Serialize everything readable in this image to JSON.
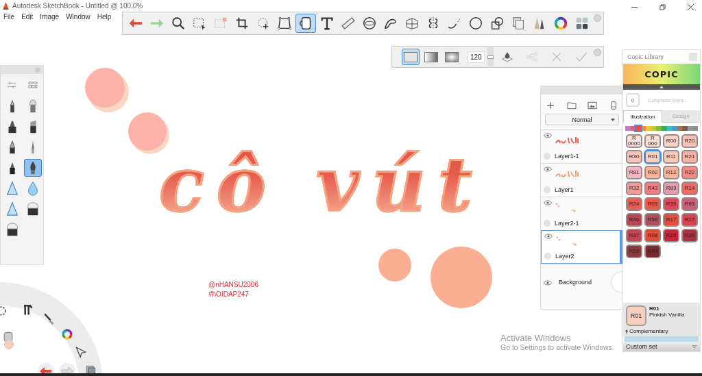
{
  "window": {
    "title": "Autodesk SketchBook - Untitled @ 100.0%"
  },
  "menu": [
    "File",
    "Edit",
    "Image",
    "Window",
    "Help"
  ],
  "toolbar": [
    {
      "kind": "undo",
      "selected": false
    },
    {
      "kind": "redo",
      "selected": false
    },
    {
      "kind": "zoom",
      "selected": false
    },
    {
      "kind": "select",
      "selected": false
    },
    {
      "kind": "select-clear",
      "selected": false
    },
    {
      "kind": "crop",
      "selected": false
    },
    {
      "kind": "transform",
      "selected": false
    },
    {
      "kind": "distort",
      "selected": false
    },
    {
      "kind": "fill",
      "selected": true
    },
    {
      "kind": "text",
      "selected": false
    },
    {
      "kind": "ruler",
      "selected": false
    },
    {
      "kind": "ellipse",
      "selected": false
    },
    {
      "kind": "curve",
      "selected": false
    },
    {
      "kind": "perspective",
      "selected": false
    },
    {
      "kind": "symmetry",
      "selected": false
    },
    {
      "kind": "stroke",
      "selected": false
    },
    {
      "kind": "predictive",
      "selected": false
    },
    {
      "kind": "shapes",
      "selected": false
    },
    {
      "kind": "layers",
      "selected": false
    },
    {
      "kind": "brushes",
      "selected": false
    },
    {
      "kind": "colorwheel",
      "selected": false
    },
    {
      "kind": "swatches",
      "selected": false
    }
  ],
  "fill_toolbar": {
    "modes": [
      {
        "kind": "solid",
        "selected": true
      },
      {
        "kind": "linear",
        "selected": false
      },
      {
        "kind": "radial",
        "selected": false
      }
    ],
    "tolerance": "120",
    "slider": {
      "level": 0.5
    }
  },
  "brushes": [
    {
      "kind": "pencil",
      "selected": false
    },
    {
      "kind": "airbrush",
      "selected": false
    },
    {
      "kind": "marker",
      "selected": false
    },
    {
      "kind": "chisel",
      "selected": false
    },
    {
      "kind": "pen",
      "selected": false
    },
    {
      "kind": "nib",
      "selected": false
    },
    {
      "kind": "ballpoint",
      "selected": false
    },
    {
      "kind": "ink",
      "selected": true
    },
    {
      "kind": "triangle",
      "selected": false
    },
    {
      "kind": "drop",
      "selected": false
    },
    {
      "kind": "triangle",
      "selected": false
    },
    {
      "kind": "eraser",
      "selected": false
    },
    {
      "kind": "eraser",
      "selected": false
    }
  ],
  "canvas": {
    "lettering": "cô vút",
    "signature": [
      "@nHANSU2006",
      "#hOIDAP247"
    ]
  },
  "layers": {
    "blend_mode": "Normal",
    "items": [
      {
        "name": "Layer1-1",
        "selected": false,
        "visible": true
      },
      {
        "name": "Layer1",
        "selected": false,
        "visible": true
      },
      {
        "name": "Layer2-1",
        "selected": false,
        "visible": true
      },
      {
        "name": "Layer2",
        "selected": true,
        "visible": true
      }
    ],
    "background": {
      "name": "Background",
      "visible": true
    }
  },
  "copic": {
    "title": "Copic Library",
    "logo": "COPIC",
    "blender_code": "0",
    "blender_name": "Colorless Blen...",
    "tabs": [
      {
        "label": "Illustration",
        "selected": true
      },
      {
        "label": "Design",
        "selected": false
      }
    ],
    "hues": [
      {
        "color": "#b784c0",
        "selected": false
      },
      {
        "color": "#e35b7a",
        "selected": false
      },
      {
        "color": "#e8504a",
        "selected": true
      },
      {
        "color": "#f08a3a",
        "selected": false
      },
      {
        "color": "#f5c040",
        "selected": false
      },
      {
        "color": "#c9c93a",
        "selected": false
      },
      {
        "color": "#7ac043",
        "selected": false
      },
      {
        "color": "#3aaa5a",
        "selected": false
      },
      {
        "color": "#3fbfc8",
        "selected": false
      },
      {
        "color": "#4a9ad8",
        "selected": false
      },
      {
        "color": "#a07850",
        "selected": false
      },
      {
        "color": "#7a5a48",
        "selected": false
      },
      {
        "color": "#8a98a0",
        "selected": false
      },
      {
        "color": "#909090",
        "selected": false
      }
    ],
    "swatches": [
      {
        "code": "R 0000",
        "color": "#f6e4dc",
        "selected": false
      },
      {
        "code": "R 000",
        "color": "#f5dfd6",
        "selected": false
      },
      {
        "code": "R00",
        "color": "#f7d3c6",
        "selected": false
      },
      {
        "code": "R20",
        "color": "#f6c0b5",
        "selected": false
      },
      {
        "code": "R30",
        "color": "#f6c6bb",
        "selected": false
      },
      {
        "code": "R01",
        "color": "#f8d0c0",
        "selected": true
      },
      {
        "code": "R11",
        "color": "#f7cbb7",
        "selected": false
      },
      {
        "code": "R21",
        "color": "#f4b1a6",
        "selected": false
      },
      {
        "code": "R81",
        "color": "#f0b6c2",
        "selected": false
      },
      {
        "code": "R02",
        "color": "#f4b49e",
        "selected": false
      },
      {
        "code": "R12",
        "color": "#f3b39a",
        "selected": false
      },
      {
        "code": "R22",
        "color": "#f08a86",
        "selected": false
      },
      {
        "code": "R32",
        "color": "#f49a95",
        "selected": false
      },
      {
        "code": "R43",
        "color": "#ee7d84",
        "selected": false
      },
      {
        "code": "R83",
        "color": "#e49bb0",
        "selected": false
      },
      {
        "code": "R14",
        "color": "#ec6a63",
        "selected": false
      },
      {
        "code": "R24",
        "color": "#e55f57",
        "selected": false
      },
      {
        "code": "R05",
        "color": "#e5584a",
        "selected": false
      },
      {
        "code": "R35",
        "color": "#da4a5a",
        "selected": false
      },
      {
        "code": "R85",
        "color": "#c4617a",
        "selected": false
      },
      {
        "code": "R46",
        "color": "#b84650",
        "selected": false
      },
      {
        "code": "R56",
        "color": "#a94e5c",
        "selected": false
      },
      {
        "code": "R17",
        "color": "#e24d3c",
        "selected": false
      },
      {
        "code": "R27",
        "color": "#d94150",
        "selected": false
      },
      {
        "code": "R37",
        "color": "#c14552",
        "selected": false
      },
      {
        "code": "R08",
        "color": "#de4e37",
        "selected": false
      },
      {
        "code": "R29",
        "color": "#c8253a",
        "selected": false
      },
      {
        "code": "R39",
        "color": "#a63344",
        "selected": false
      },
      {
        "code": "R59",
        "color": "#8e3a3c",
        "selected": false
      },
      {
        "code": "R89",
        "color": "#7a2a2c",
        "selected": false
      }
    ],
    "current": {
      "code": "R01",
      "heading": "R01",
      "name": "Pinkish Vanilla",
      "color": "#f8d0c0"
    },
    "complementary": "Complementary",
    "set": "Custom set"
  },
  "activation": {
    "title": "Activate Windows",
    "text": "Go to Settings to activate Windows."
  }
}
